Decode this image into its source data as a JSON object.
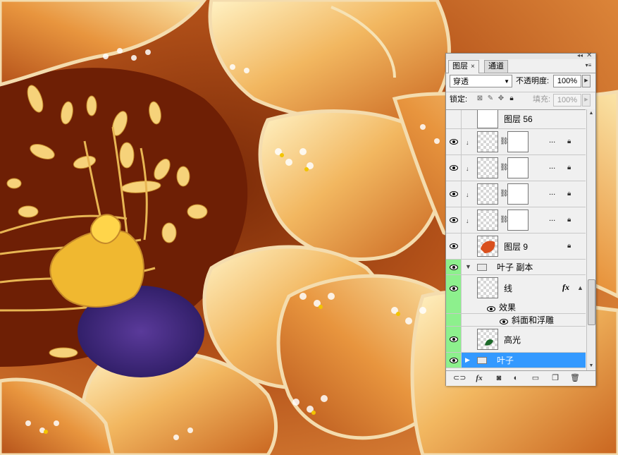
{
  "panel": {
    "tabs": [
      {
        "label": "图层",
        "active": true
      },
      {
        "label": "通道",
        "active": false
      }
    ],
    "close_glyph": "×",
    "blend_mode": "穿透",
    "opacity_label": "不透明度:",
    "opacity_value": "100%",
    "lock_label": "锁定:",
    "fill_label": "填充:",
    "fill_value": "100%"
  },
  "layers": [
    {
      "name": "图层 56",
      "visible": false
    },
    {
      "name": "",
      "clipped": true,
      "has_mask": true,
      "ellipsis": "..."
    },
    {
      "name": "",
      "clipped": true,
      "has_mask": true,
      "ellipsis": "..."
    },
    {
      "name": "",
      "clipped": true,
      "has_mask": true,
      "ellipsis": "..."
    },
    {
      "name": "",
      "clipped": true,
      "has_mask": true,
      "ellipsis": "..."
    },
    {
      "name": "图层 9",
      "visible": true
    },
    {
      "name": "叶子 副本",
      "group": true,
      "expanded": true
    },
    {
      "name": "线",
      "fx": "fx"
    },
    {
      "name": "效果"
    },
    {
      "name": "斜面和浮雕"
    },
    {
      "name": "高光"
    },
    {
      "name": "叶子",
      "group": true,
      "selected": true
    }
  ],
  "icons": [
    "eye-icon",
    "lock-icon",
    "chain-icon",
    "folder-icon",
    "fx-icon",
    "link-layers-icon",
    "layer-style-icon",
    "add-mask-icon",
    "adjustment-layer-icon",
    "new-group-icon",
    "new-layer-icon",
    "trash-icon",
    "panel-menu-icon",
    "dropdown-arrow-icon"
  ],
  "colors": {
    "selected_row": "#3399ff",
    "eye_highlight": "#8df08d",
    "panel_bg": "#f0f0f0"
  }
}
